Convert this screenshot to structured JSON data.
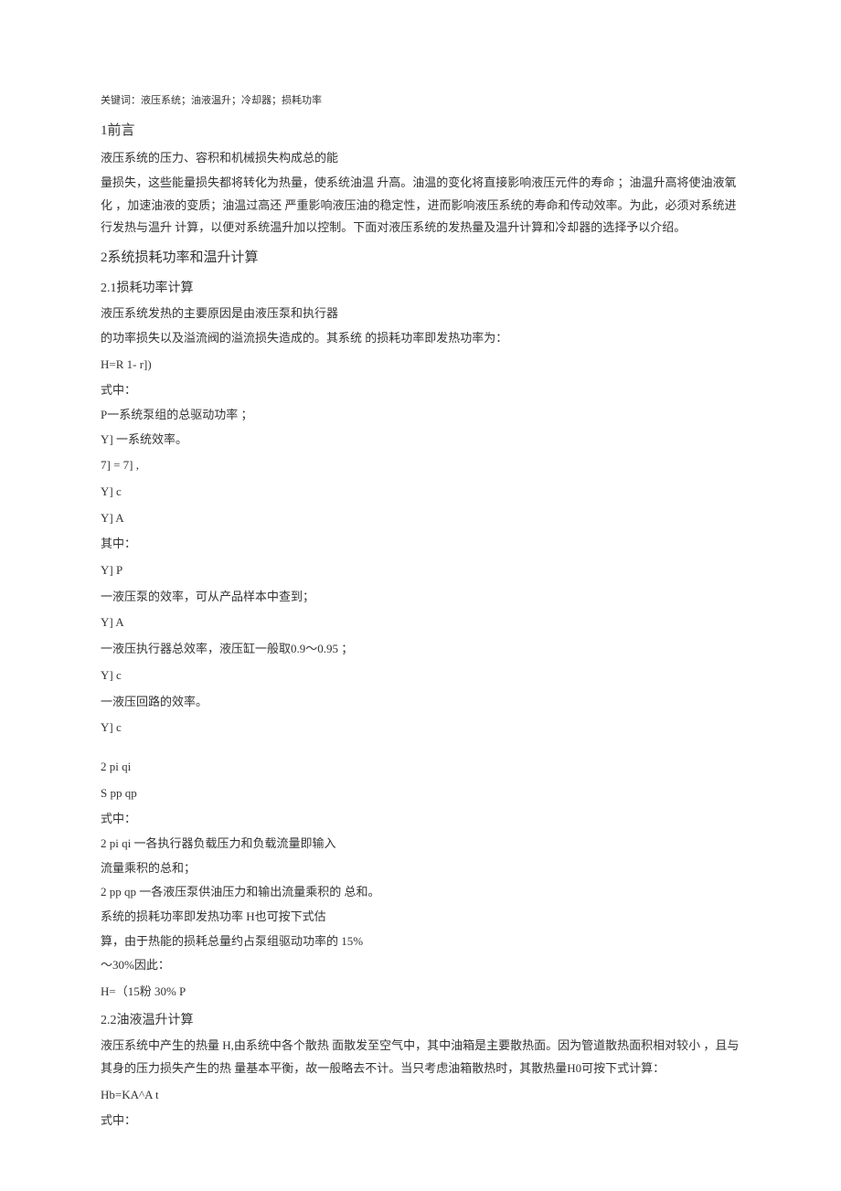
{
  "keywords": "关键词：液压系统；油液温升；冷却器；损耗功率",
  "section1": {
    "title": "1前言",
    "p1": "液压系统的压力、容积和机械损失构成总的能",
    "p2": "量损失，这些能量损失都将转化为热量，使系统油温 升高。油温的变化将直接影响液压元件的寿命 ；油温升高将使油液氧化 ，加速油液的变质；油温过高还 严重影响液压油的稳定性，进而影响液压系统的寿命和传动效率。为此，必须对系统进行发热与温升 计算，以便对系统温升加以控制。下面对液压系统的发热量及温升计算和冷却器的选择予以介绍。"
  },
  "section2": {
    "title": "2系统损耗功率和温升计算",
    "s21": {
      "title": "2.1损耗功率计算",
      "p1": "液压系统发热的主要原因是由液压泵和执行器",
      "p2": "的功率损失以及溢流阀的溢流损失造成的。其系统 的损耗功率即发热功率为：",
      "f1": "H=R 1- r])",
      "f2": "式中：",
      "f3": "P一系统泵组的总驱动功率    ；",
      "f4": "Y] 一系统效率。",
      "f5": "7] = 7] ,",
      "f6": "Y] c",
      "f7": "Y] A",
      "f8": "其中：",
      "f9": "Y] P",
      "f10": "一液压泵的效率，可从产品样本中查到；",
      "f11": "Y] A",
      "f12": "一液压执行器总效率，液压缸一般取0.9〜0.95 ；",
      "f13": "Y] c",
      "f14": "一液压回路的效率。",
      "f15": "Y] c",
      "f16": "2 pi qi",
      "f17": "S pp qp",
      "f18": "式中：",
      "f19": "2 pi qi 一各执行器负载压力和负载流量即输入",
      "f20": "流量乘积的总和；",
      "f21": "2 pp qp 一各液压泵供油压力和输出流量乘积的 总和。",
      "p3": "系统的损耗功率即发热功率    H也可按下式估",
      "p4": "算，由于热能的损耗总量约占泵组驱动功率的         15%",
      "p5": "〜30%因此：",
      "f22": "H=（15粉  30% P"
    },
    "s22": {
      "title": "2.2油液温升计算",
      "p1": "液压系统中产生的热量 H,由系统中各个散热 面散发至空气中，其中油箱是主要散热面。因为管道散热面积相对较小 ，且与其身的压力损失产生的热 量基本平衡，故一般略去不计。当只考虑油箱散热时，其散热量H0可按下式计算：",
      "f1": "Hb=KA^A t",
      "f2": "式中："
    }
  }
}
